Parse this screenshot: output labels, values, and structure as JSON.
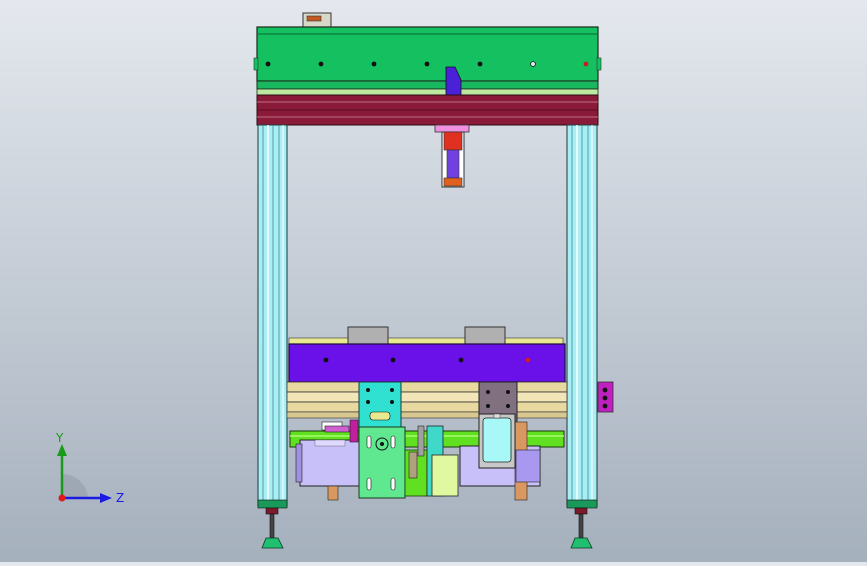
{
  "viewport": {
    "background_top": "#e4e8ee",
    "background_bottom": "#a5b0bd"
  },
  "triad": {
    "y_label": "Y",
    "z_label": "Z",
    "y_color": "#1a9a1a",
    "z_color": "#1a1ae0",
    "origin_color": "#e01a1a"
  },
  "colors": {
    "top_beam": "#14c060",
    "crossbar": "#8a1a3a",
    "upright": "#a8eef4",
    "carriage": "#6a10e8",
    "slide_rail": "#e8d9a0",
    "shaft": "#60e020",
    "plate": "#60e890",
    "cylinder_rod": "#e03020",
    "foot": "#20c070"
  }
}
